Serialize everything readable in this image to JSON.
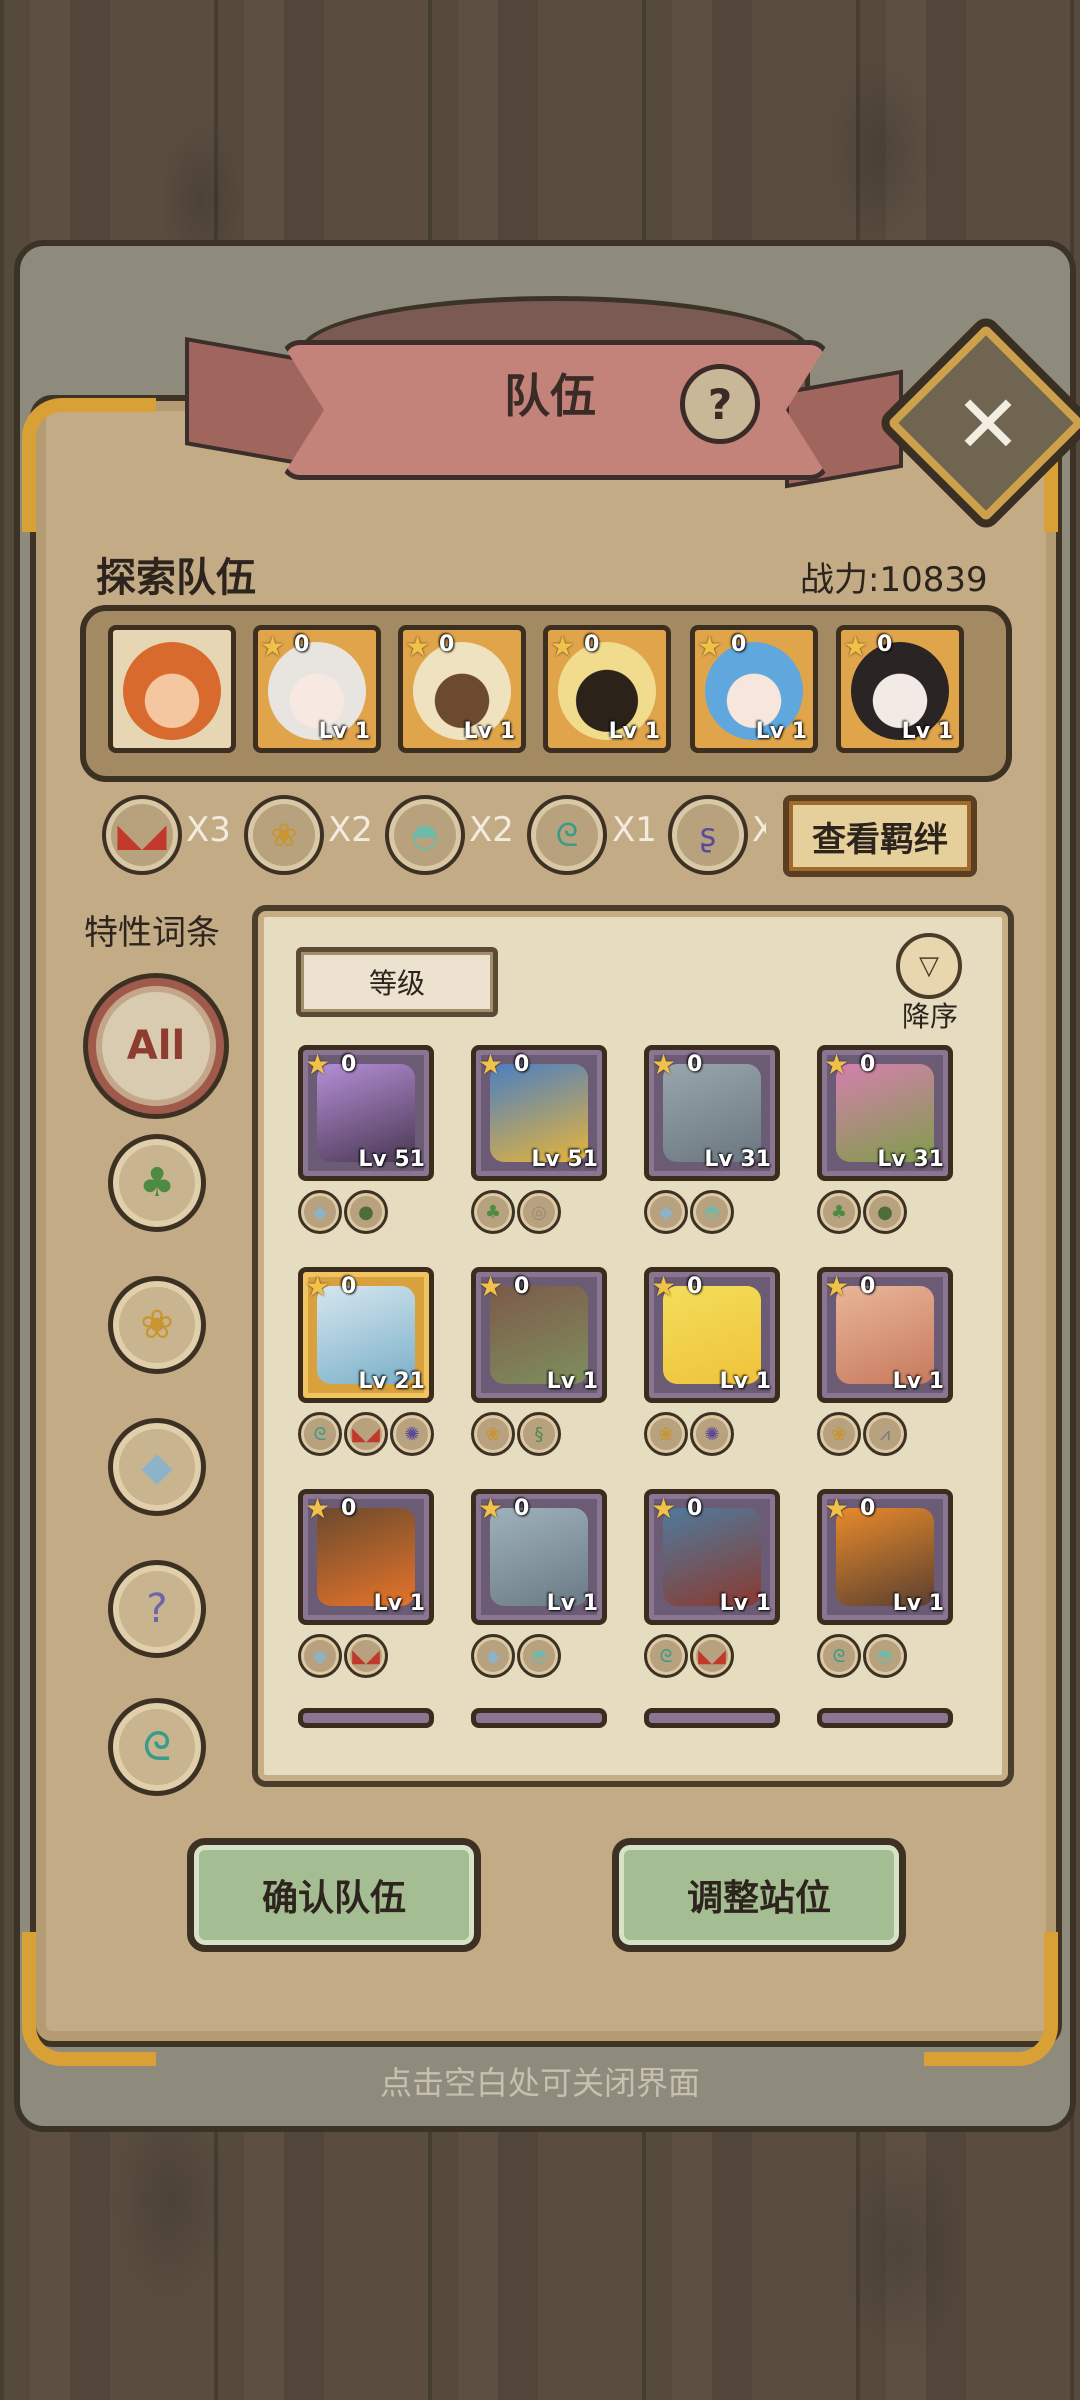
{
  "dialog": {
    "title": "队伍",
    "help_icon": "question-icon",
    "close_icon": "close-icon"
  },
  "team": {
    "section_title": "探索队伍",
    "power_text": "战力:10839",
    "slots": [
      {
        "type": "leader",
        "portrait": "orange-hair-hero"
      },
      {
        "count": "0",
        "level": "Lv 1",
        "portrait": "white-hair-girl"
      },
      {
        "count": "0",
        "level": "Lv 1",
        "portrait": "blonde-dark-skin"
      },
      {
        "count": "0",
        "level": "Lv 1",
        "portrait": "black-yellow-creature"
      },
      {
        "count": "0",
        "level": "Lv 1",
        "portrait": "blue-hair-girl"
      },
      {
        "count": "0",
        "level": "Lv 1",
        "portrait": "black-hair-girl"
      }
    ]
  },
  "bonds": {
    "items": [
      {
        "icon": "red-eyes-icon",
        "count": "X3"
      },
      {
        "icon": "paw-icon",
        "count": "X2"
      },
      {
        "icon": "ghost-icon",
        "count": "X2"
      },
      {
        "icon": "spiral-icon",
        "count": "X1"
      },
      {
        "icon": "purple-rune-icon",
        "count": "X"
      }
    ],
    "view_button": "查看羁绊"
  },
  "filters": {
    "label": "特性词条",
    "items": [
      {
        "name": "All",
        "icon": "all-badge"
      },
      {
        "name": "plant",
        "icon": "leaf-icon"
      },
      {
        "name": "beast",
        "icon": "paw-icon"
      },
      {
        "name": "crystal",
        "icon": "crystal-icon"
      },
      {
        "name": "unknown",
        "icon": "question-icon"
      },
      {
        "name": "spiral",
        "icon": "spiral-icon"
      }
    ]
  },
  "sort": {
    "tab_label": "等级",
    "order_label": "降序",
    "order_icon": "triangle-down-icon"
  },
  "monsters": [
    {
      "count": "0",
      "level": "Lv 51",
      "frame": "purple",
      "traits": [
        "crystal-icon",
        "frog-icon"
      ]
    },
    {
      "count": "0",
      "level": "Lv 51",
      "frame": "purple",
      "traits": [
        "leaf-icon",
        "ring-icon"
      ]
    },
    {
      "count": "0",
      "level": "Lv 31",
      "frame": "purple",
      "traits": [
        "crystal-icon",
        "ghost-icon"
      ]
    },
    {
      "count": "0",
      "level": "Lv 31",
      "frame": "purple",
      "traits": [
        "leaf-icon",
        "frog-icon"
      ]
    },
    {
      "count": "0",
      "level": "Lv 21",
      "frame": "gold",
      "traits": [
        "spiral-icon",
        "red-eyes-icon",
        "gear-icon"
      ]
    },
    {
      "count": "0",
      "level": "Lv 1",
      "frame": "purple",
      "traits": [
        "paw-icon",
        "snake-icon"
      ]
    },
    {
      "count": "0",
      "level": "Lv 1",
      "frame": "purple",
      "traits": [
        "paw-icon",
        "gear-icon"
      ]
    },
    {
      "count": "0",
      "level": "Lv 1",
      "frame": "purple",
      "traits": [
        "paw-icon",
        "claw-icon"
      ]
    },
    {
      "count": "0",
      "level": "Lv 1",
      "frame": "purple",
      "traits": [
        "crystal-icon",
        "red-eyes-icon"
      ]
    },
    {
      "count": "0",
      "level": "Lv 1",
      "frame": "purple",
      "traits": [
        "crystal-icon",
        "ghost-icon"
      ]
    },
    {
      "count": "0",
      "level": "Lv 1",
      "frame": "purple",
      "traits": [
        "spiral-icon",
        "red-eyes-icon"
      ]
    },
    {
      "count": "0",
      "level": "Lv 1",
      "frame": "purple",
      "traits": [
        "spiral-icon",
        "ghost-icon"
      ]
    }
  ],
  "actions": {
    "confirm_team": "确认队伍",
    "adjust_position": "调整站位"
  },
  "hint": "点击空白处可关闭界面",
  "colors": {
    "panel": "#c3ab86",
    "ribbon": "#c4837a",
    "green_button": "#a5bd93",
    "gold_frame": "#d9a13e",
    "purple_frame": "#6c5b74"
  }
}
